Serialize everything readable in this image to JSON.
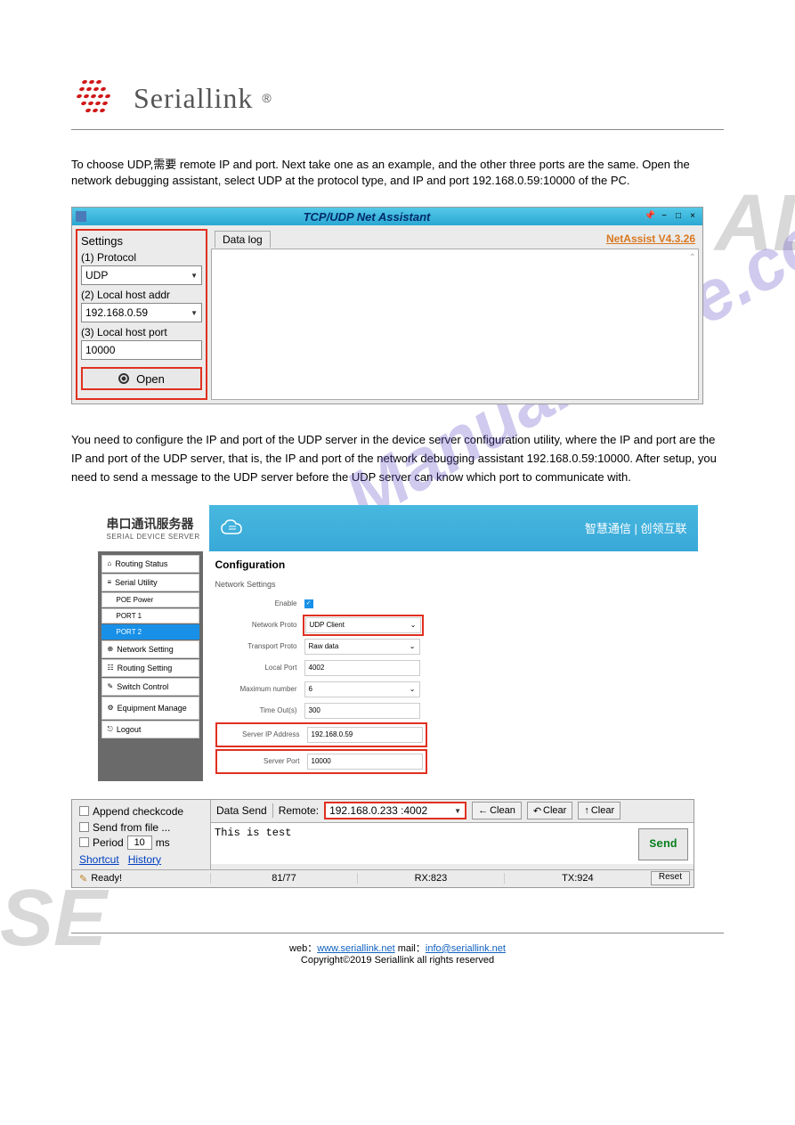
{
  "watermarks": {
    "left": "SE",
    "right": "AL",
    "mid": "ManualShive.com"
  },
  "header": {
    "brand": "Seriallink",
    "reg": "®"
  },
  "intro_text": "To choose UDP,需要 remote IP and port. Next take one as an example, and the other three ports are the same. Open the network debugging assistant, select UDP at the protocol type, and IP and port 192.168.0.59:10000 of the PC.",
  "ss1": {
    "title": "TCP/UDP Net Assistant",
    "settings_title": "Settings",
    "protocol_label": "(1) Protocol",
    "protocol_value": "UDP",
    "host_addr_label": "(2) Local host addr",
    "host_addr_value": "192.168.0.59",
    "host_port_label": "(3) Local host port",
    "host_port_value": "10000",
    "open_btn": "Open",
    "datalog_tab": "Data log",
    "version": "NetAssist V4.3.26"
  },
  "mid_text": "You need to configure the IP and port of the UDP server in the device server configuration utility, where the IP and port are the IP and port of the UDP server, that is, the IP and port of the network debugging assistant 192.168.0.59:10000. After setup, you need to send a message to the UDP server before the UDP server can know which port to communicate with.",
  "ss2": {
    "logo_cn": "串口通讯服务器",
    "logo_en": "SERIAL DEVICE SERVER",
    "header_right": "智慧通信 | 创领互联",
    "nav": {
      "routing_status": "Routing Status",
      "serial_utility": "Serial Utility",
      "poe_power": "POE Power",
      "port1": "PORT 1",
      "port2": "PORT 2",
      "network_setting": "Network Setting",
      "routing_setting": "Routing Setting",
      "switch_control": "Switch Control",
      "equipment_manage": "Equipment Manage",
      "logout": "Logout"
    },
    "config_title": "Configuration",
    "ns_title": "Network Settings",
    "form": {
      "enable_label": "Enable",
      "network_proto_label": "Network Proto",
      "network_proto_value": "UDP Client",
      "transport_proto_label": "Transport Proto",
      "transport_proto_value": "Raw data",
      "local_port_label": "Local Port",
      "local_port_value": "4002",
      "max_num_label": "Maximum number",
      "max_num_value": "6",
      "timeout_label": "Time Out(s)",
      "timeout_value": "300",
      "server_ip_label": "Server IP Address",
      "server_ip_value": "192.168.0.59",
      "server_port_label": "Server Port",
      "server_port_value": "10000"
    }
  },
  "ss3": {
    "append_checkcode": "Append checkcode",
    "send_from_file": "Send from file ...",
    "period_label": "Period",
    "period_value": "10",
    "period_unit": "ms",
    "shortcut": "Shortcut",
    "history": "History",
    "data_send": "Data Send",
    "remote_label": "Remote:",
    "remote_value": "192.168.0.233 :4002",
    "clean_btn": "Clean",
    "clear_btn1": "Clear",
    "clear_btn2": "Clear",
    "text_content": "This is test",
    "send_btn": "Send",
    "ready": "Ready!",
    "counter": "81/77",
    "rx": "RX:823",
    "tx": "TX:924",
    "reset": "Reset"
  },
  "footer": {
    "left": "web：",
    "web": "www.seriallink.net",
    "mid": "  mail：",
    "email": "info@seriallink.net",
    "right": "Copyright©2019 Seriallink all rights reserved"
  }
}
